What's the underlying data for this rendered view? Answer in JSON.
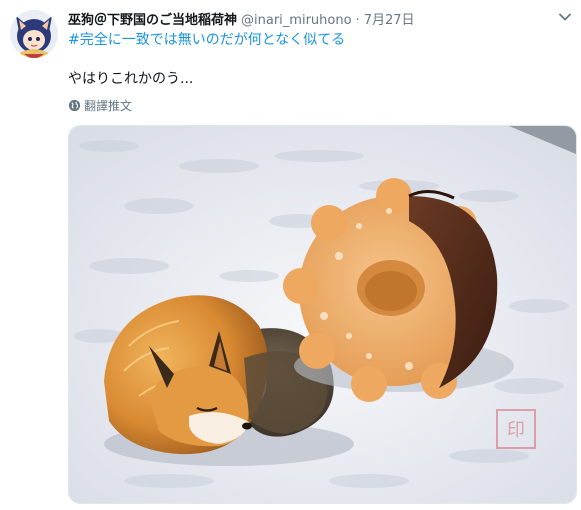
{
  "tweet": {
    "author": {
      "display_name": "巫狗＠下野国のご当地稲荷神",
      "handle": "@inari_miruhono",
      "avatar_icon": "avatar-icon"
    },
    "separator": "·",
    "timestamp": "7月27日",
    "text": {
      "hashtag": "#完全に一致では無いのだが何となく似てる",
      "line2": "やはりこれかのう..."
    },
    "translate_label": "翻譯推文",
    "media": {
      "subject": "fox curled up in snow beside a doughnut",
      "watermark_glyph": "印"
    }
  },
  "colors": {
    "link": "#1b95e0",
    "secondary_text": "#657786",
    "border": "#e1e8ed"
  }
}
